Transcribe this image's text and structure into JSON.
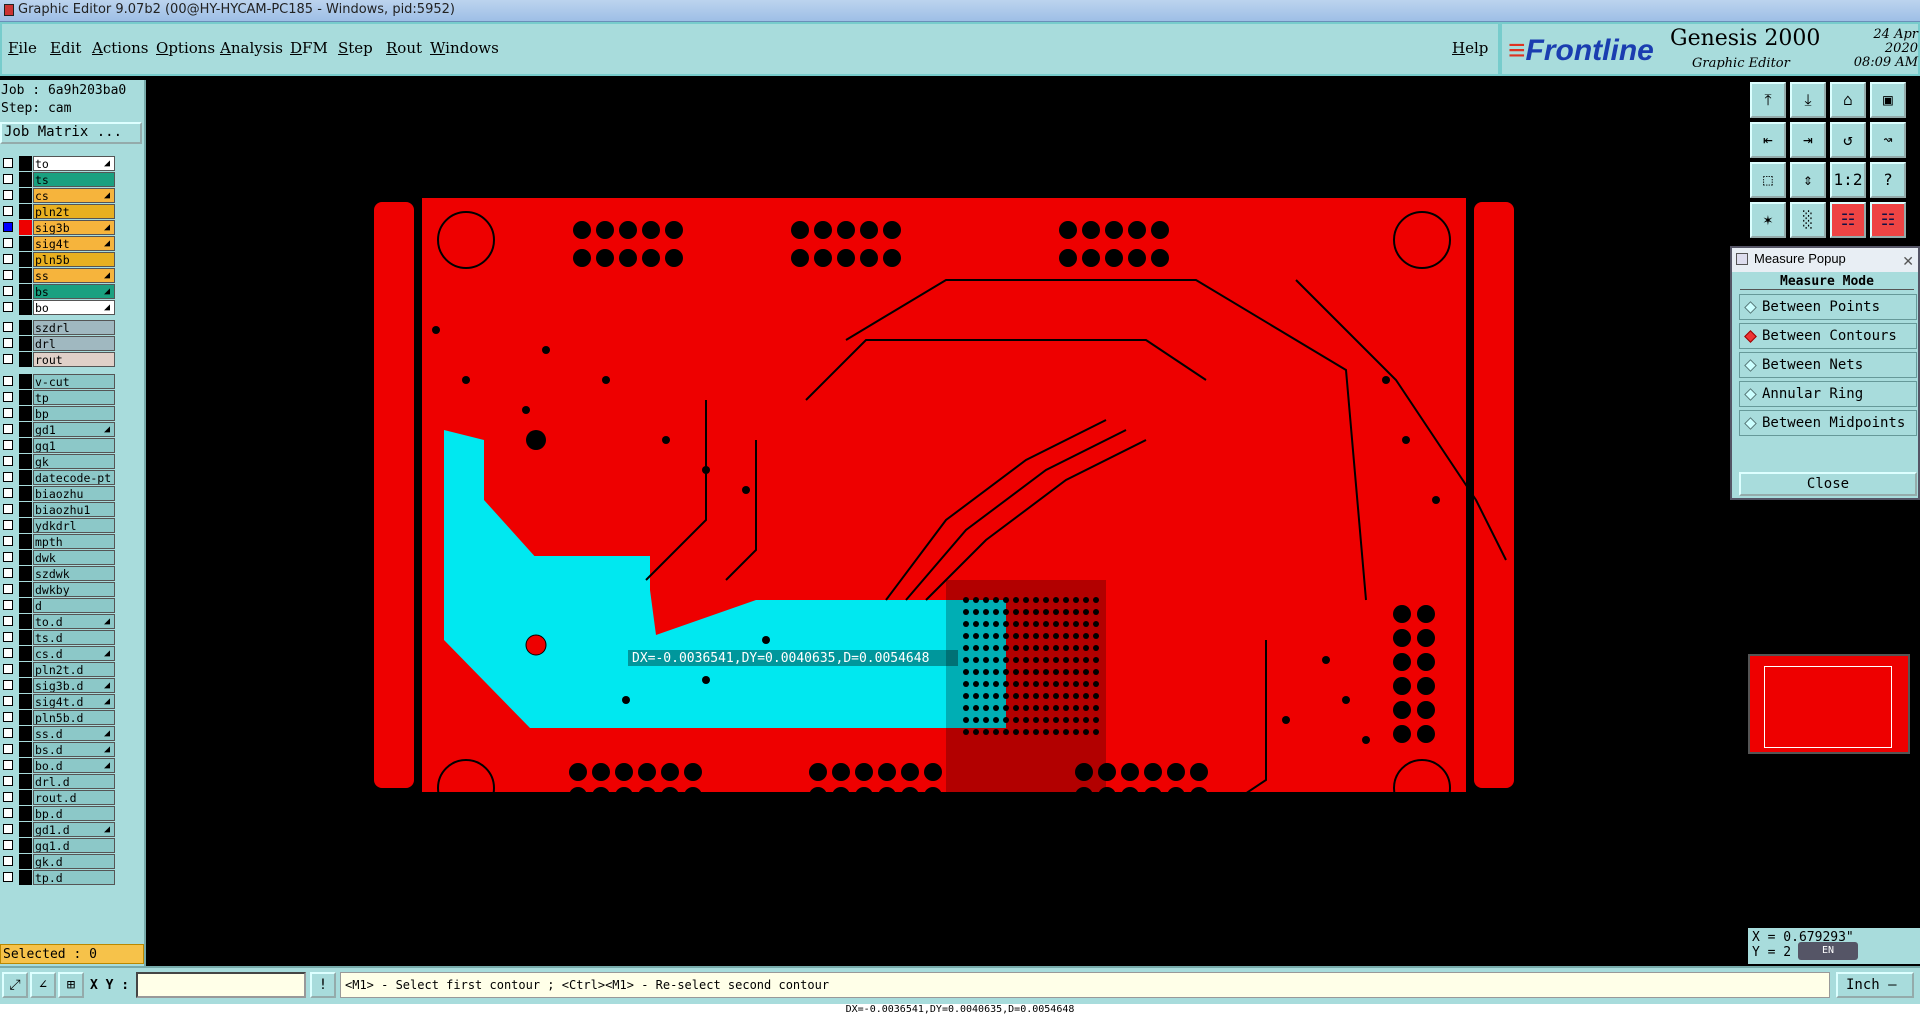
{
  "titlebar": {
    "title": "Graphic Editor 9.07b2 (00@HY-HYCAM-PC185 - Windows, pid:5952)"
  },
  "menu": {
    "items": [
      "File",
      "Edit",
      "Actions",
      "Options",
      "Analysis",
      "DFM",
      "Step",
      "Rout",
      "Windows"
    ],
    "help": "Help"
  },
  "brand": {
    "logo": "Frontline",
    "product": "Genesis 2000",
    "subtitle": "Graphic Editor",
    "date": "24 Apr 2020",
    "time": "08:09 AM"
  },
  "job": {
    "job": "Job : 6a9h203ba0",
    "step": "Step: cam",
    "matrix_button": "Job Matrix ..."
  },
  "layers": [
    {
      "name": "to",
      "color": "#ffffff",
      "flag": "◢"
    },
    {
      "name": "ts",
      "color": "#1aa080",
      "flag": ""
    },
    {
      "name": "cs",
      "color": "#f6b43c",
      "flag": "◢"
    },
    {
      "name": "pln2t",
      "color": "#e8b020",
      "flag": ""
    },
    {
      "name": "sig3b",
      "color": "#f6b43c",
      "flag": "◢",
      "active": true
    },
    {
      "name": "sig4t",
      "color": "#f6b43c",
      "flag": "◢"
    },
    {
      "name": "pln5b",
      "color": "#e8b020",
      "flag": ""
    },
    {
      "name": "ss",
      "color": "#f6b43c",
      "flag": "◢"
    },
    {
      "name": "bs",
      "color": "#1aa080",
      "flag": "◢"
    },
    {
      "name": "bo",
      "color": "#ffffff",
      "flag": "◢"
    },
    {
      "name": "szdrl",
      "color": "#a0b8c0",
      "flag": ""
    },
    {
      "name": "drl",
      "color": "#a0b8c0",
      "flag": ""
    },
    {
      "name": "rout",
      "color": "#e0d0c8",
      "flag": ""
    },
    {
      "name": "v-cut",
      "color": "#8cc8c8",
      "flag": ""
    },
    {
      "name": "tp",
      "color": "#8cc8c8",
      "flag": ""
    },
    {
      "name": "bp",
      "color": "#8cc8c8",
      "flag": ""
    },
    {
      "name": "gd1",
      "color": "#8cc8c8",
      "flag": "◢"
    },
    {
      "name": "gq1",
      "color": "#8cc8c8",
      "flag": ""
    },
    {
      "name": "gk",
      "color": "#8cc8c8",
      "flag": ""
    },
    {
      "name": "datecode-pt",
      "color": "#8cc8c8",
      "flag": ""
    },
    {
      "name": "biaozhu",
      "color": "#8cc8c8",
      "flag": ""
    },
    {
      "name": "biaozhu1",
      "color": "#8cc8c8",
      "flag": ""
    },
    {
      "name": "ydkdrl",
      "color": "#8cc8c8",
      "flag": ""
    },
    {
      "name": "mpth",
      "color": "#8cc8c8",
      "flag": ""
    },
    {
      "name": "dwk",
      "color": "#8cc8c8",
      "flag": ""
    },
    {
      "name": "szdwk",
      "color": "#8cc8c8",
      "flag": ""
    },
    {
      "name": "dwkby",
      "color": "#8cc8c8",
      "flag": ""
    },
    {
      "name": "d",
      "color": "#8cc8c8",
      "flag": ""
    },
    {
      "name": "to.d",
      "color": "#8cc8c8",
      "flag": "◢"
    },
    {
      "name": "ts.d",
      "color": "#8cc8c8",
      "flag": ""
    },
    {
      "name": "cs.d",
      "color": "#8cc8c8",
      "flag": "◢"
    },
    {
      "name": "pln2t.d",
      "color": "#8cc8c8",
      "flag": ""
    },
    {
      "name": "sig3b.d",
      "color": "#8cc8c8",
      "flag": "◢"
    },
    {
      "name": "sig4t.d",
      "color": "#8cc8c8",
      "flag": "◢"
    },
    {
      "name": "pln5b.d",
      "color": "#8cc8c8",
      "flag": ""
    },
    {
      "name": "ss.d",
      "color": "#8cc8c8",
      "flag": "◢"
    },
    {
      "name": "bs.d",
      "color": "#8cc8c8",
      "flag": "◢"
    },
    {
      "name": "bo.d",
      "color": "#8cc8c8",
      "flag": "◢"
    },
    {
      "name": "drl.d",
      "color": "#8cc8c8",
      "flag": ""
    },
    {
      "name": "rout.d",
      "color": "#8cc8c8",
      "flag": ""
    },
    {
      "name": "bp.d",
      "color": "#8cc8c8",
      "flag": ""
    },
    {
      "name": "gd1.d",
      "color": "#8cc8c8",
      "flag": "◢"
    },
    {
      "name": "gq1.d",
      "color": "#8cc8c8",
      "flag": ""
    },
    {
      "name": "gk.d",
      "color": "#8cc8c8",
      "flag": ""
    },
    {
      "name": "tp.d",
      "color": "#8cc8c8",
      "flag": ""
    }
  ],
  "selected": "Selected : 0",
  "canvas": {
    "board_color": "#ee0000",
    "highlight_color": "#00e8f0",
    "measure_text": "DX=-0.0036541,DY=0.0040635,D=0.0054648"
  },
  "right_tools": [
    "pan-up-icon",
    "pan-down-icon",
    "home-icon",
    "window-icon",
    "pan-left-icon",
    "pan-right-icon",
    "zoom-back-icon",
    "redraw-icon",
    "fit-icon",
    "zoom-fit-icon",
    "scale-icon",
    "help-icon",
    "snap-icon",
    "grid-icon",
    "nets-icon",
    "drc-icon"
  ],
  "measure_popup": {
    "title": "Measure Popup",
    "mode_title": "Measure Mode",
    "modes": [
      "Between Points",
      "Between Contours",
      "Between Nets",
      "Annular Ring",
      "Between Midpoints"
    ],
    "selected_mode": "Between Contours",
    "close": "Close"
  },
  "coords": {
    "x": "X = 0.679293\"",
    "y": "Y = 2"
  },
  "ime": "EN",
  "bottom": {
    "xy_label": "X Y :",
    "xy_value": "",
    "prompt": "<M1> - Select first contour ; <Ctrl><M1> - Re-select second contour",
    "units": "Inch"
  },
  "status_line": "DX=-0.0036541,DY=0.0040635,D=0.0054648"
}
